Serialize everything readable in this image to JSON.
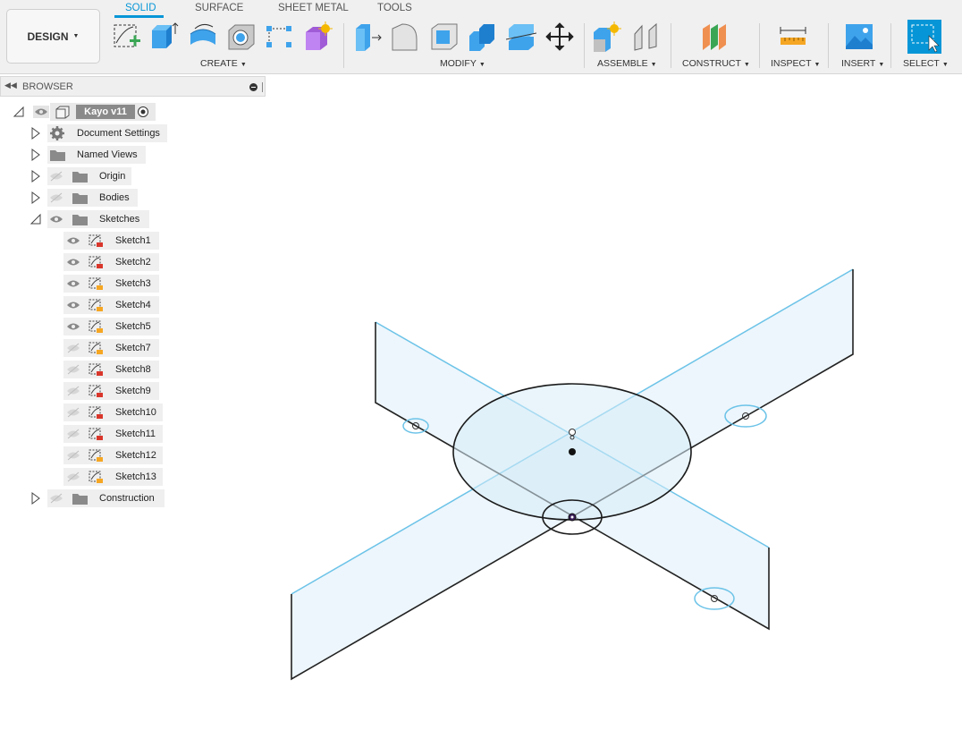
{
  "toolbar": {
    "design_label": "DESIGN",
    "tabs": [
      {
        "label": "SOLID",
        "active": true
      },
      {
        "label": "SURFACE",
        "active": false
      },
      {
        "label": "SHEET METAL",
        "active": false
      },
      {
        "label": "TOOLS",
        "active": false
      }
    ],
    "groups": {
      "create": "CREATE",
      "modify": "MODIFY",
      "assemble": "ASSEMBLE",
      "construct": "CONSTRUCT",
      "inspect": "INSPECT",
      "insert": "INSERT",
      "select": "SELECT"
    },
    "accent_color": "#0696d7"
  },
  "browser": {
    "title": "BROWSER",
    "root": {
      "label": "Kayo v11"
    },
    "items": [
      {
        "label": "Document Settings"
      },
      {
        "label": "Named Views"
      },
      {
        "label": "Origin"
      },
      {
        "label": "Bodies"
      },
      {
        "label": "Sketches"
      }
    ],
    "sketches": [
      {
        "label": "Sketch1",
        "visible": true
      },
      {
        "label": "Sketch2",
        "visible": true
      },
      {
        "label": "Sketch3",
        "visible": true
      },
      {
        "label": "Sketch4",
        "visible": true
      },
      {
        "label": "Sketch5",
        "visible": true
      },
      {
        "label": "Sketch7",
        "visible": false
      },
      {
        "label": "Sketch8",
        "visible": false
      },
      {
        "label": "Sketch9",
        "visible": false
      },
      {
        "label": "Sketch10",
        "visible": false
      },
      {
        "label": "Sketch11",
        "visible": false
      },
      {
        "label": "Sketch12",
        "visible": false
      },
      {
        "label": "Sketch13",
        "visible": false
      }
    ],
    "construction": {
      "label": "Construction"
    }
  }
}
